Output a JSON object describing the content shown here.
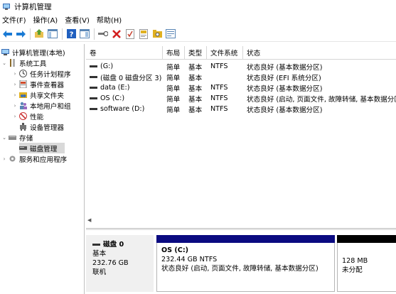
{
  "window": {
    "title": "计算机管理"
  },
  "menu": [
    "文件(F)",
    "操作(A)",
    "查看(V)",
    "帮助(H)"
  ],
  "toolbar": [
    {
      "icon": "back-arrow-icon",
      "color": "#1a7ad4"
    },
    {
      "icon": "forward-arrow-icon",
      "color": "#1a7ad4"
    },
    {
      "icon": "up-folder-icon",
      "color": "#5a9e2f"
    },
    {
      "icon": "console-tree-icon",
      "color": "#5a86b5"
    },
    {
      "icon": "help-icon",
      "color": "#1f5fbf"
    },
    {
      "icon": "view-icon",
      "color": "#5a86b5"
    },
    {
      "icon": "connect-icon",
      "color": "#666666"
    },
    {
      "icon": "delete-icon",
      "color": "#d31f1f"
    },
    {
      "icon": "checklist-icon",
      "color": "#c7422f"
    },
    {
      "icon": "document-icon",
      "color": "#e0b020"
    },
    {
      "icon": "folder-search-icon",
      "color": "#e0b020"
    },
    {
      "icon": "properties-icon",
      "color": "#5a86b5"
    }
  ],
  "tree": [
    {
      "label": "计算机管理(本地)",
      "level": 0,
      "expander": "",
      "icon": "computer-management-icon"
    },
    {
      "label": "系统工具",
      "level": 1,
      "expander": "⌄",
      "icon": "system-tools-icon"
    },
    {
      "label": "任务计划程序",
      "level": 2,
      "expander": "›",
      "icon": "task-scheduler-icon"
    },
    {
      "label": "事件查看器",
      "level": 2,
      "expander": "›",
      "icon": "event-viewer-icon"
    },
    {
      "label": "共享文件夹",
      "level": 2,
      "expander": "›",
      "icon": "shared-folders-icon"
    },
    {
      "label": "本地用户和组",
      "level": 2,
      "expander": "›",
      "icon": "local-users-icon"
    },
    {
      "label": "性能",
      "level": 2,
      "expander": "›",
      "icon": "performance-icon"
    },
    {
      "label": "设备管理器",
      "level": 2,
      "expander": "",
      "icon": "device-manager-icon"
    },
    {
      "label": "存储",
      "level": 1,
      "expander": "⌄",
      "icon": "storage-icon"
    },
    {
      "label": "磁盘管理",
      "level": 2,
      "expander": "",
      "icon": "disk-management-icon",
      "selected": true
    },
    {
      "label": "服务和应用程序",
      "level": 1,
      "expander": "›",
      "icon": "services-icon"
    }
  ],
  "columns": [
    "卷",
    "布局",
    "类型",
    "文件系统",
    "状态"
  ],
  "volumes": [
    {
      "name": "(G:)",
      "layout": "简单",
      "type": "基本",
      "fs": "NTFS",
      "status": "状态良好 (基本数据分区)"
    },
    {
      "name": "(磁盘 0 磁盘分区 3)",
      "layout": "简单",
      "type": "基本",
      "fs": "",
      "status": "状态良好 (EFI 系统分区)"
    },
    {
      "name": "data (E:)",
      "layout": "简单",
      "type": "基本",
      "fs": "NTFS",
      "status": "状态良好 (基本数据分区)"
    },
    {
      "name": "OS (C:)",
      "layout": "简单",
      "type": "基本",
      "fs": "NTFS",
      "status": "状态良好 (启动, 页面文件, 故障转储, 基本数据分区)"
    },
    {
      "name": "software (D:)",
      "layout": "简单",
      "type": "基本",
      "fs": "NTFS",
      "status": "状态良好 (基本数据分区)"
    }
  ],
  "disk": {
    "name": "磁盘 0",
    "type": "基本",
    "size": "232.76 GB",
    "state": "联机",
    "partitions": [
      {
        "name": "OS  (C:)",
        "size": "232.44 GB NTFS",
        "status": "状态良好 (启动, 页面文件, 故障转储, 基本数据分区)",
        "band_color": "#0a0a80"
      },
      {
        "size": "128 MB",
        "status": "未分配",
        "band_color": "#000000"
      }
    ]
  }
}
